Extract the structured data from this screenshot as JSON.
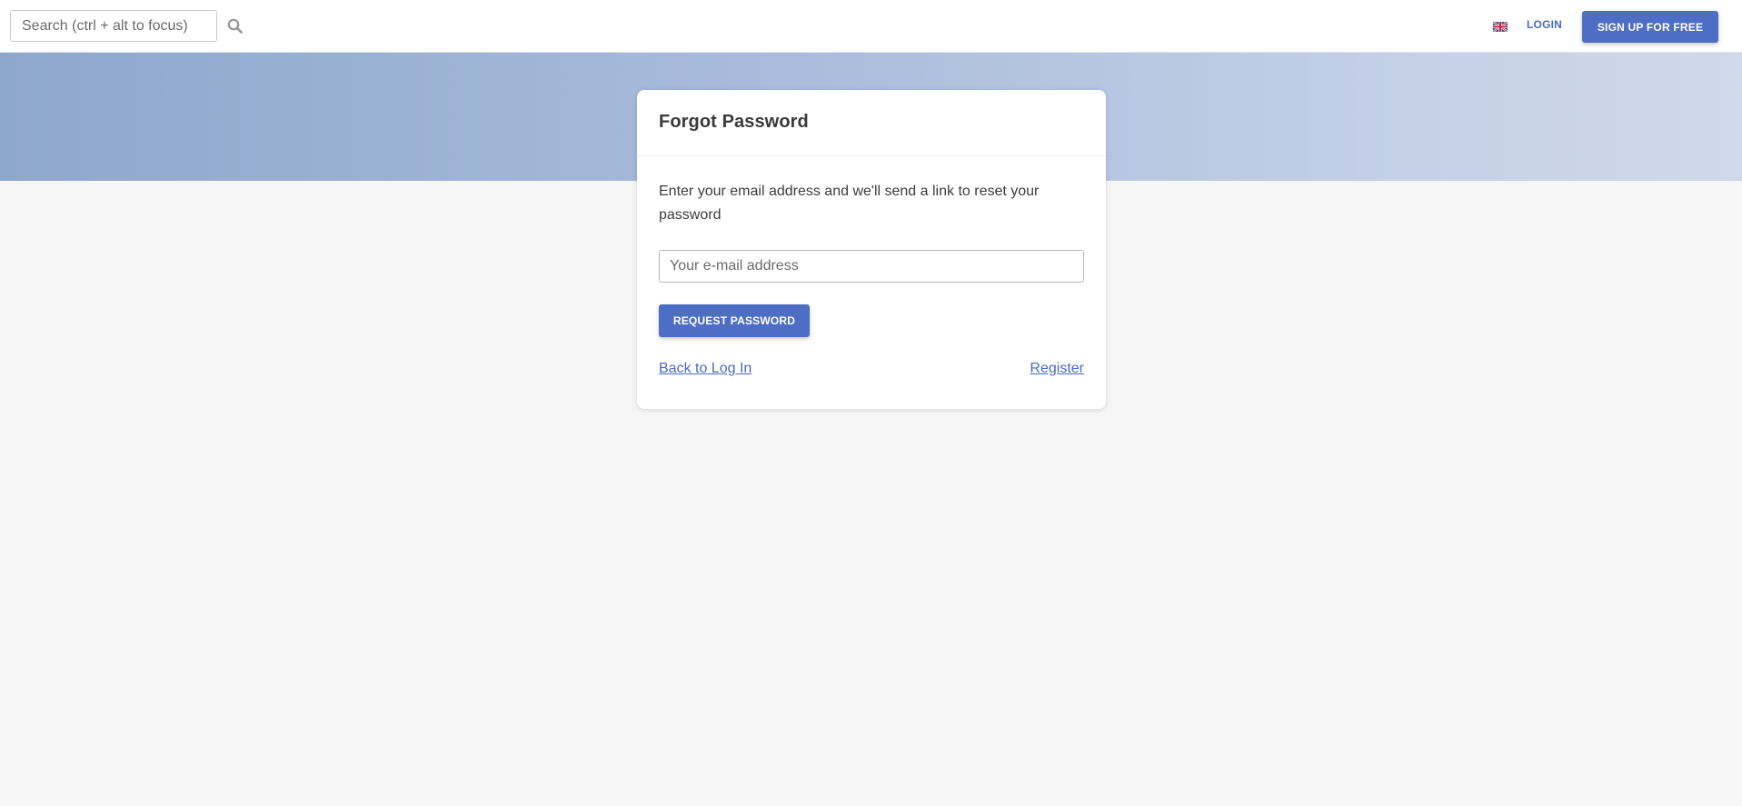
{
  "header": {
    "search_placeholder": "Search (ctrl + alt to focus)",
    "search_icon": "search-icon",
    "language_icon": "uk-flag-icon",
    "login_label": "LOGIN",
    "signup_label": "SIGN UP FOR FREE"
  },
  "card": {
    "title": "Forgot Password",
    "description": "Enter your email address and we'll send a link to reset your password",
    "email_placeholder": "Your e-mail address",
    "email_value": "",
    "submit_label": "REQUEST PASSWORD",
    "back_link_label": "Back to Log In",
    "register_link_label": "Register"
  },
  "colors": {
    "accent": "#4d6ec4",
    "link": "#4a6bc2",
    "background": "#f6f6f6",
    "hero_gradient_start": "#8ea7cc",
    "hero_gradient_end": "#cfd9ea"
  }
}
